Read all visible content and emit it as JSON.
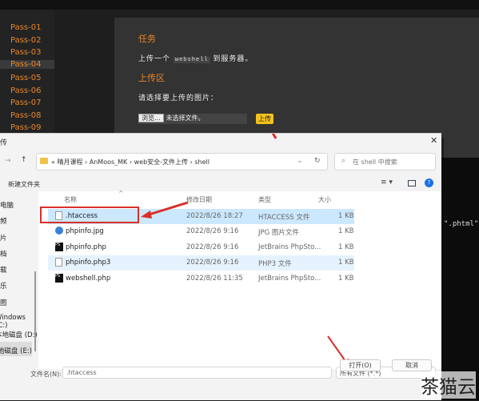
{
  "sidebar": {
    "items": [
      "Pass-01",
      "Pass-02",
      "Pass-03",
      "Pass-04",
      "Pass-05",
      "Pass-06",
      "Pass-07",
      "Pass-08",
      "Pass-09"
    ],
    "active": "Pass-04"
  },
  "main": {
    "task_heading": "任务",
    "task_text_pre": "上传一个",
    "task_code": "webshell",
    "task_text_post": "到服务器。",
    "upload_heading": "上传区",
    "choose_label": "请选择要上传的图片：",
    "browse_button": "浏览...",
    "no_file": "未选择文件。",
    "upload_button": "上传"
  },
  "code_snippet": "\".phtml\",",
  "dialog": {
    "title": "传",
    "close": "✕",
    "breadcrumb": [
      "«",
      "晴月课程",
      "AnMoos_MK",
      "web安全-文件上传",
      "shell"
    ],
    "search_placeholder": "在 shell 中搜索",
    "new_folder": "新建文件夹",
    "nav": [
      "电脑",
      "频",
      "片",
      "档",
      "载",
      "乐",
      "图",
      "Windows (C:)",
      "本地磁盘 (D:)",
      "本地磁盘 (E:)"
    ],
    "columns": [
      "名称",
      "修改日期",
      "类型",
      "大小"
    ],
    "files": [
      {
        "name": ".htaccess",
        "date": "2022/8/26 18:27",
        "type": "HTACCESS 文件",
        "size": "1 KB",
        "icon": "file-icon"
      },
      {
        "name": "phpinfo.jpg",
        "date": "2022/8/26 9:16",
        "type": "JPG 图片文件",
        "size": "1 KB",
        "icon": "image-icon"
      },
      {
        "name": "phpinfo.php",
        "date": "2022/8/26 9:16",
        "type": "JetBrains PhpSto...",
        "size": "1 KB",
        "icon": "phpstorm-icon"
      },
      {
        "name": "phpinfo.php3",
        "date": "2022/8/26 9:16",
        "type": "PHP3 文件",
        "size": "1 KB",
        "icon": "file-icon"
      },
      {
        "name": "webshell.php",
        "date": "2022/8/26 11:35",
        "type": "JetBrains PhpSto...",
        "size": "1 KB",
        "icon": "phpstorm-icon"
      }
    ],
    "filename_label": "文件名(N):",
    "filename_value": ".htaccess",
    "filter": "所有文件 (*.*)",
    "open_button": "打开(O)",
    "cancel_button": "取消"
  },
  "watermark": "茶猫云",
  "colors": {
    "accent": "#e8862b",
    "selection": "#cce8ff",
    "annotation": "#d9302a"
  }
}
